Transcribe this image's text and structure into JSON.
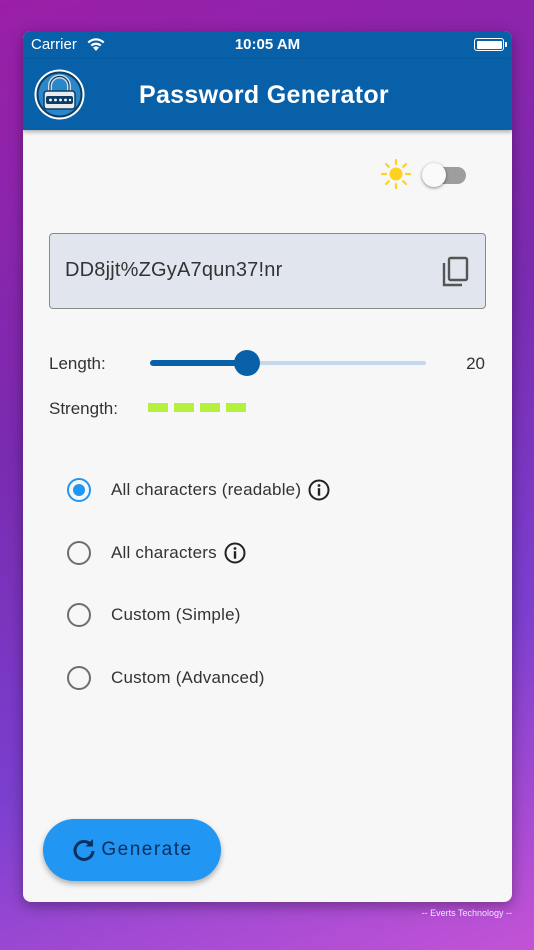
{
  "status_bar": {
    "carrier": "Carrier",
    "time": "10:05 AM"
  },
  "app_bar": {
    "title": "Password Generator",
    "logo_icon": "padlock-logo-icon"
  },
  "theme": {
    "icon": "sun-icon",
    "dark_mode_on": false
  },
  "password": {
    "value": "DD8jjt%ZGyA7qun37!nr",
    "copy_icon": "copy-icon"
  },
  "length": {
    "label": "Length:",
    "value": "20",
    "slider_fraction": 0.35
  },
  "strength": {
    "label": "Strength:",
    "level": 4,
    "color": "#b6f03f"
  },
  "options": [
    {
      "label": "All characters (readable)",
      "selected": true,
      "info": true
    },
    {
      "label": "All characters",
      "selected": false,
      "info": true
    },
    {
      "label": "Custom (Simple)",
      "selected": false,
      "info": false
    },
    {
      "label": "Custom (Advanced)",
      "selected": false,
      "info": false
    }
  ],
  "generate_button": {
    "label": "Generate",
    "icon": "refresh-icon"
  },
  "credit": "-- Everts Technology --",
  "colors": {
    "primary": "#0860a8",
    "accent": "#2196f3",
    "background": "#f7f7f7"
  }
}
